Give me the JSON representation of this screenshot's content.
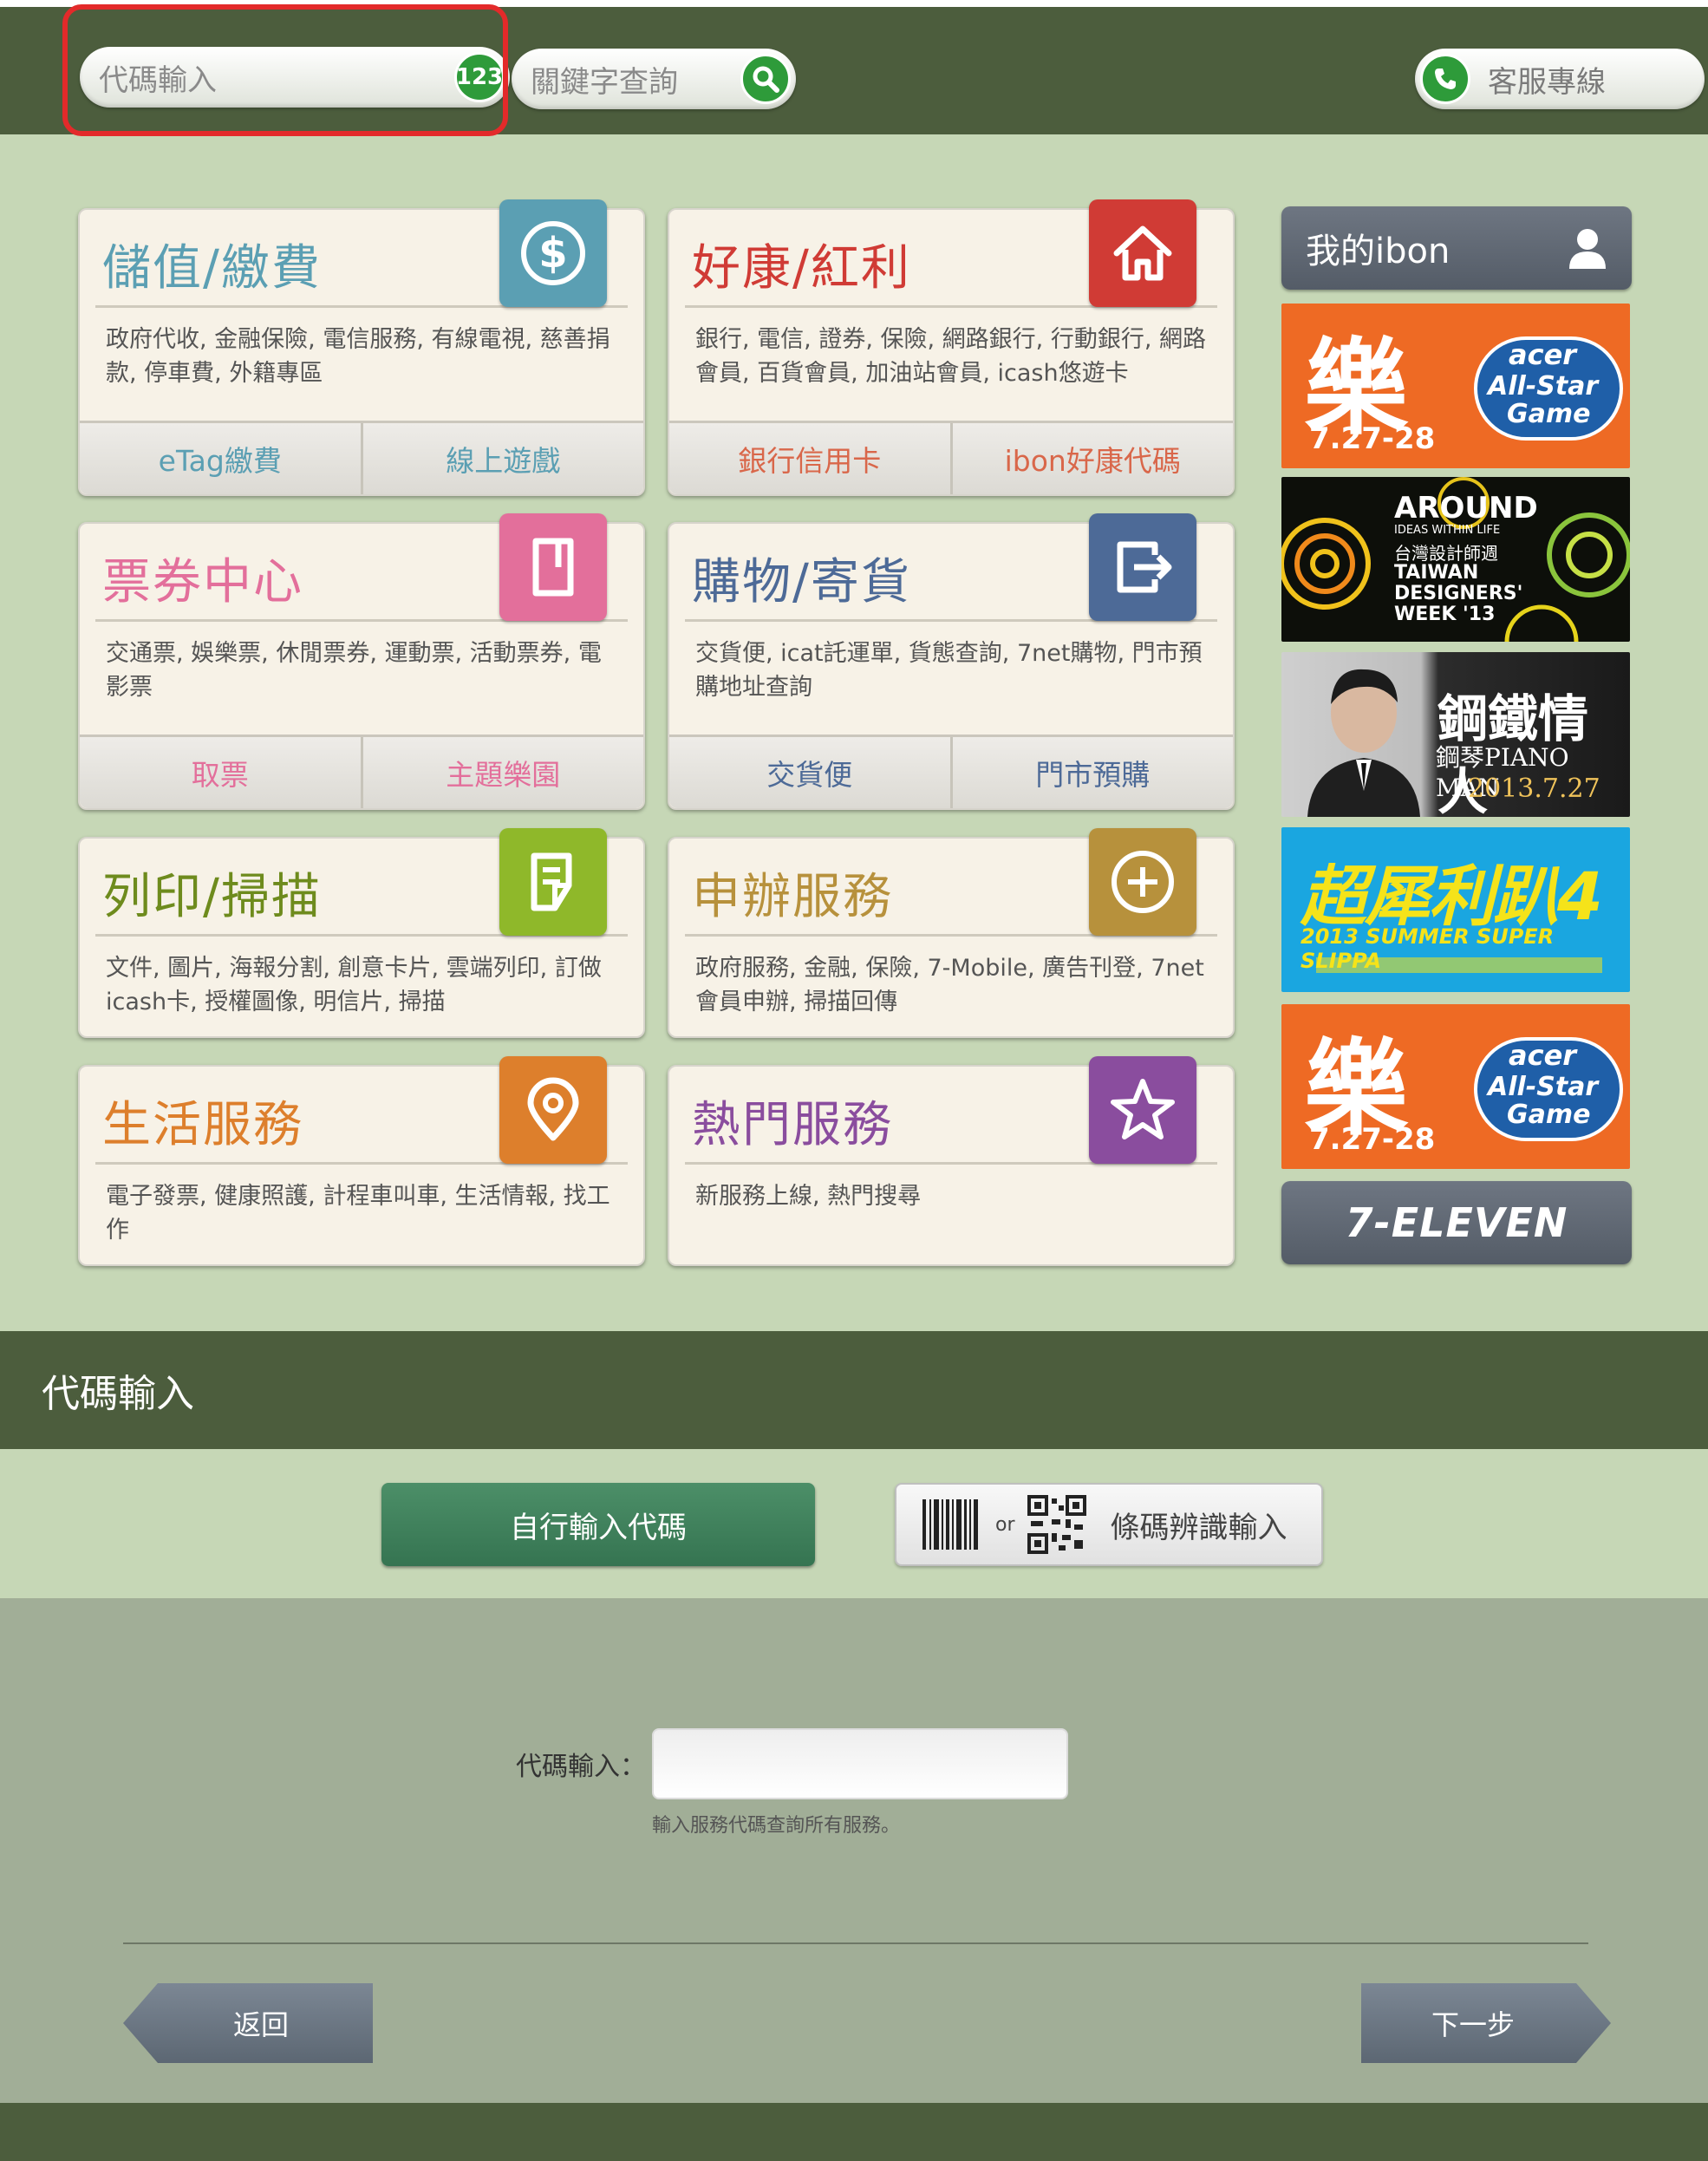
{
  "header": {
    "code_input_placeholder": "代碼輸入",
    "code_badge": "123",
    "keyword_placeholder": "關鍵字查詢",
    "hotline_label": "客服專線"
  },
  "tiles": [
    {
      "title": "儲值/繳費",
      "desc": "政府代收, 金融保險, 電信服務, 有線電視, 慈善捐款, 停車費, 外籍專區",
      "buttons": [
        "eTag繳費",
        "線上遊戲"
      ],
      "color": "#5b9fb3"
    },
    {
      "title": "好康/紅利",
      "desc": "銀行, 電信, 證券, 保險, 網路銀行, 行動銀行, 網路會員, 百貨會員, 加油站會員, icash悠遊卡",
      "buttons": [
        "銀行信用卡",
        "ibon好康代碼"
      ],
      "color": "#d03b35"
    },
    {
      "title": "票券中心",
      "desc": "交通票, 娛樂票, 休閒票券, 運動票, 活動票券, 電影票",
      "buttons": [
        "取票",
        "主題樂園"
      ],
      "color": "#e36f9b"
    },
    {
      "title": "購物/寄貨",
      "desc": "交貨便, icat託運單, 貨態查詢, 7net購物, 門市預購地址查詢",
      "buttons": [
        "交貨便",
        "門市預購"
      ],
      "color": "#4d6a97"
    },
    {
      "title": "列印/掃描",
      "desc": "文件, 圖片, 海報分割, 創意卡片, 雲端列印, 訂做icash卡, 授權圖像, 明信片, 掃描",
      "buttons": [],
      "color": "#8fb82a"
    },
    {
      "title": "申辦服務",
      "desc": "政府服務, 金融, 保險, 7-Mobile, 廣告刊登, 7net會員申辦, 掃描回傳",
      "buttons": [],
      "color": "#b7913c"
    },
    {
      "title": "生活服務",
      "desc": "電子發票, 健康照護, 計程車叫車, 生活情報, 找工作",
      "buttons": [],
      "color": "#dd7f2c"
    },
    {
      "title": "熱門服務",
      "desc": "新服務上線, 熱門搜尋",
      "buttons": [],
      "color": "#8a4d9e"
    }
  ],
  "sidebar": {
    "my_ibon": "我的ibon",
    "banners": [
      {
        "big": "樂",
        "brand": "acer",
        "line1": "All-Star",
        "line2": "Game",
        "date": "7.27-28"
      },
      {
        "line1": "AROUND",
        "line2": "IDEAS WITHIN LIFE",
        "line3": "台灣設計師週",
        "line4": "TAIWAN",
        "line5": "DESIGNERS'",
        "line6": "WEEK '13"
      },
      {
        "title": "鋼鐵情人",
        "subtitle": "鋼琴PIANO MAN",
        "date": "2013.7.27"
      },
      {
        "title": "超犀利趴4",
        "subtitle": "2013 SUMMER SUPER SLIPPA"
      },
      {
        "big": "樂",
        "brand": "acer",
        "line1": "All-Star",
        "line2": "Game",
        "date": "7.27-28"
      }
    ],
    "seven_eleven": "7-ELEVEN"
  },
  "code_section": {
    "heading": "代碼輸入",
    "manual_button": "自行輸入代碼",
    "or_text": "or",
    "barcode_button": "條碼辨識輸入",
    "field_label": "代碼輸入：",
    "field_value": "",
    "hint": "輸入服務代碼查詢所有服務。",
    "back_button": "返回",
    "next_button": "下一步"
  }
}
